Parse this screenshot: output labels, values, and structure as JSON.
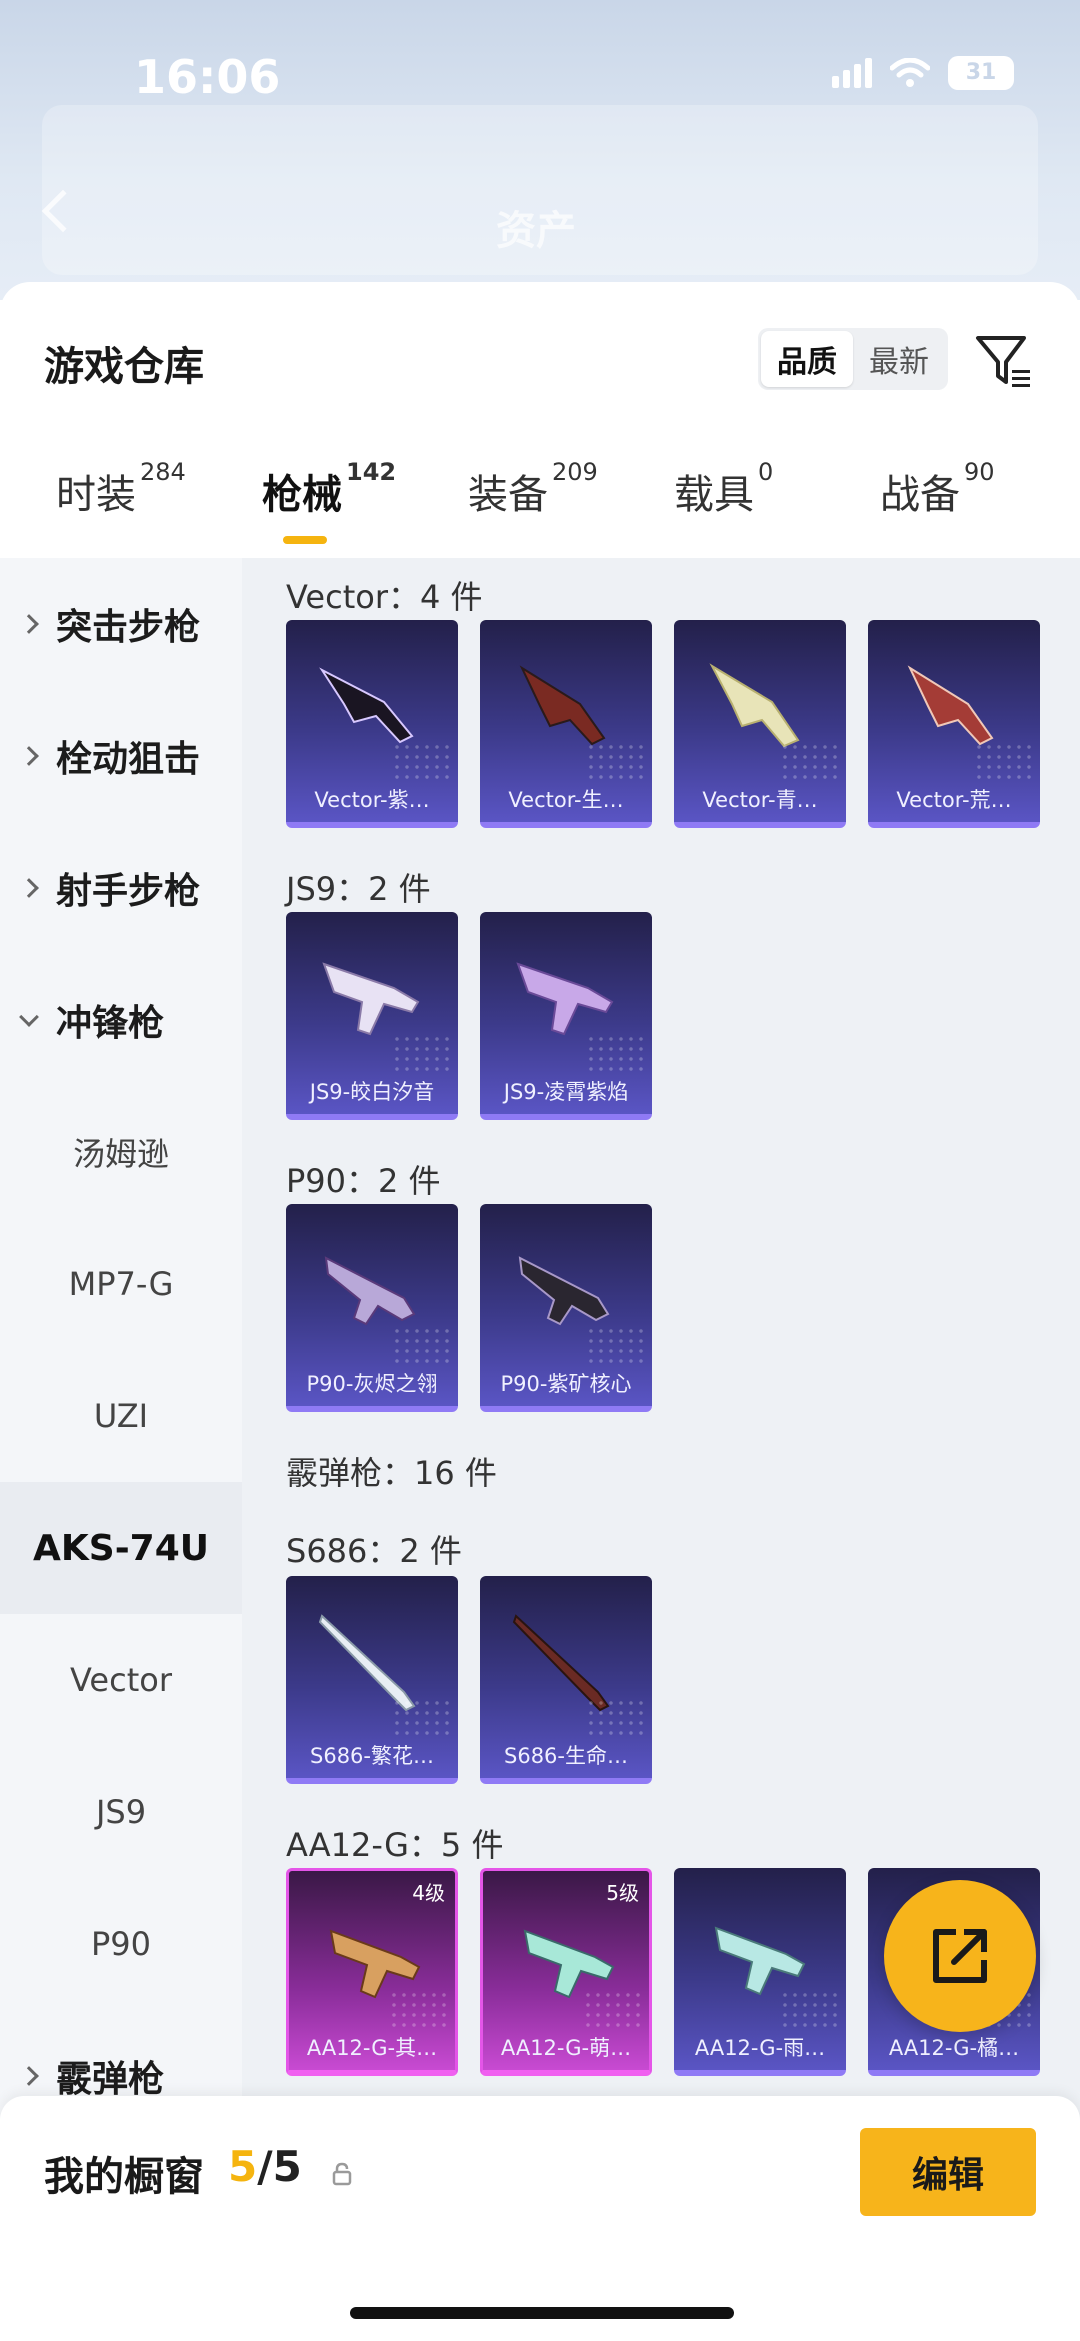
{
  "status_bar": {
    "time": "16:06",
    "battery": "31"
  },
  "header_bg": {
    "title": "资产"
  },
  "sheet": {
    "title": "游戏仓库",
    "sort": {
      "options": [
        "品质",
        "最新"
      ],
      "selected": "品质"
    }
  },
  "tabs": [
    {
      "label": "时装",
      "count": "284"
    },
    {
      "label": "枪械",
      "count": "142",
      "active": true
    },
    {
      "label": "装备",
      "count": "209"
    },
    {
      "label": "载具",
      "count": "0"
    },
    {
      "label": "战备",
      "count": "90"
    }
  ],
  "categories": {
    "assault": "突击步枪",
    "bolt": "栓动狙击",
    "marksman": "射手步枪",
    "smg": "冲锋枪",
    "shotgun": "霰弹枪"
  },
  "subcategories": [
    "汤姆逊",
    "MP7-G",
    "UZI",
    "AKS-74U",
    "Vector",
    "JS9",
    "P90"
  ],
  "selected_subcategory": "AKS-74U",
  "groups": {
    "vector": {
      "title": "Vector：4 件",
      "items": [
        "Vector-紫…",
        "Vector-生…",
        "Vector-青…",
        "Vector-荒…"
      ]
    },
    "js9": {
      "title": "JS9：2 件",
      "items": [
        "JS9-皎白汐音",
        "JS9-凌霄紫焰"
      ]
    },
    "p90": {
      "title": "P90：2 件",
      "items": [
        "P90-灰烬之翎",
        "P90-紫矿核心"
      ]
    },
    "shotgun": {
      "title": "霰弹枪：16 件"
    },
    "s686": {
      "title": "S686：2 件",
      "items": [
        "S686-繁花…",
        "S686-生命…"
      ]
    },
    "aa12": {
      "title": "AA12-G：5 件",
      "items": [
        "AA12-G-其…",
        "AA12-G-萌…",
        "AA12-G-雨…",
        "AA12-G-橘…"
      ],
      "levels": [
        "4级",
        "5级"
      ]
    }
  },
  "showcase": {
    "label": "我的橱窗",
    "current": "5",
    "total": "/5",
    "edit_label": "编辑"
  },
  "colors": {
    "accent": "#f5b40f",
    "card_purple": "#3c3a8a",
    "card_pink": "#c84ad2"
  },
  "icons": [
    "back-icon",
    "filter-icon",
    "share-icon",
    "lock-icon",
    "chevron-right-icon",
    "chevron-down-icon"
  ]
}
